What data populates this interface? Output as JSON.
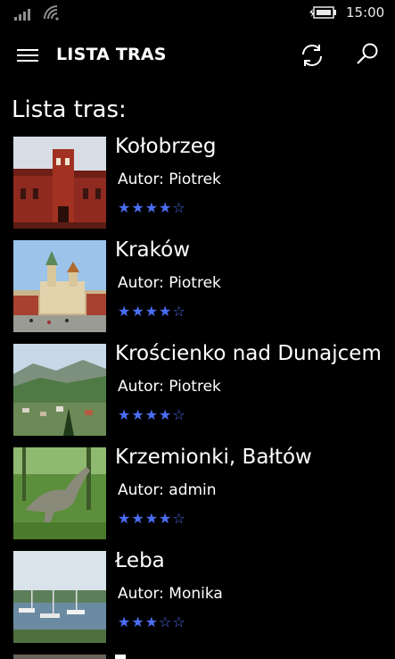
{
  "status_bar": {
    "time": "15:00",
    "signal_icon": "cellular-signal-icon",
    "wifi_icon": "wifi-icon",
    "battery_icon": "battery-charging-icon"
  },
  "app_bar": {
    "menu_icon": "hamburger-menu-icon",
    "title": "LISTA TRAS",
    "refresh_icon": "refresh-icon",
    "search_icon": "search-icon"
  },
  "list_heading": "Lista tras:",
  "routes": [
    {
      "name": "Kołobrzeg",
      "author": "Autor: Piotrek",
      "rating": 4,
      "max_rating": 5,
      "image_icon": "town-hall-photo"
    },
    {
      "name": "Kraków",
      "author": "Autor: Piotrek",
      "rating": 4,
      "max_rating": 5,
      "image_icon": "wawel-castle-photo"
    },
    {
      "name": "Krościenko nad Dunajcem",
      "author": "Autor: Piotrek",
      "rating": 4,
      "max_rating": 5,
      "image_icon": "mountain-valley-photo"
    },
    {
      "name": "Krzemionki, Bałtów",
      "author": "Autor: admin",
      "rating": 4,
      "max_rating": 5,
      "image_icon": "dinosaur-park-photo"
    },
    {
      "name": "Łeba",
      "author": "Autor: Monika",
      "rating": 3,
      "max_rating": 5,
      "image_icon": "harbor-photo"
    }
  ],
  "colors": {
    "background": "#000000",
    "text": "#ffffff",
    "star": "#4b6ef5"
  }
}
